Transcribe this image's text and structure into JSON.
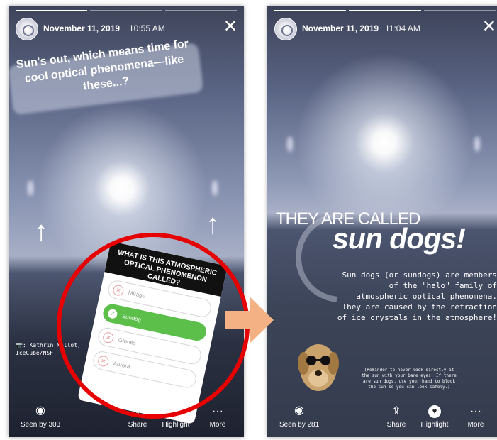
{
  "left_story": {
    "date": "November 11, 2019",
    "time": "10:55 AM",
    "caption": "Sun's out, which means time for cool optical phenomena—like these...?",
    "credit": "📷: Kathrin Mallot, IceCube/NSF",
    "poll": {
      "question": "WHAT IS THIS ATMOSPHERIC OPTICAL PHENOMENON CALLED?",
      "options": [
        "Mirage",
        "Sundog",
        "Glories",
        "Aurora"
      ],
      "selected": "Sundog"
    },
    "seen_by": "Seen by 303"
  },
  "right_story": {
    "date": "November 11, 2019",
    "time": "11:04 AM",
    "heading_small": "THEY ARE CALLED",
    "heading_big": "sun dogs!",
    "body": "Sun dogs (or sundogs) are members of the \"halo\" family of atmospheric optical phenomena. They are caused by the refraction of ice crystals in the atmosphere!",
    "note": "(Reminder to never look directly at the sun with your bare eyes! If there are sun dogs, use your hand to block the sun so you can look safely.)",
    "seen_by": "Seen by 281"
  },
  "actions": {
    "share": "Share",
    "highlight": "Highlight",
    "more": "More"
  },
  "colors": {
    "ring": "#e60000",
    "arrow": "#f4b183",
    "poll_selected": "#5bbf4a"
  },
  "icons": [
    "close-icon",
    "eye-icon",
    "share-icon",
    "heart-icon",
    "more-icon",
    "check-icon",
    "x-circle-icon"
  ]
}
